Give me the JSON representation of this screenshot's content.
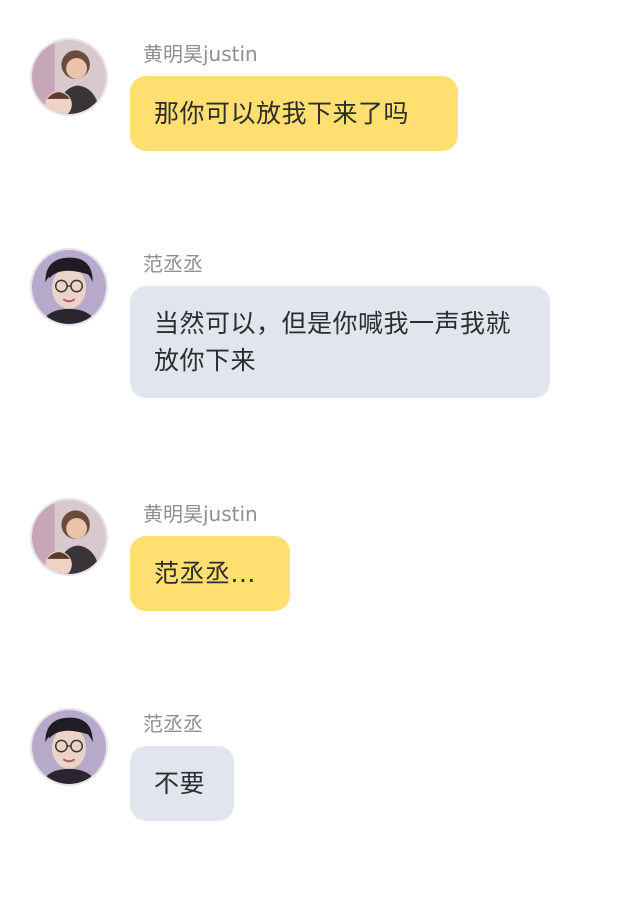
{
  "colors": {
    "bubble_justin": "#ffdf6f",
    "bubble_fan": "#e1e6ee",
    "name_text": "#8f8f8f",
    "message_text": "#2d2d2d"
  },
  "messages": [
    {
      "sender": "黄明昊justin",
      "text": "那你可以放我下来了吗",
      "avatar_icon": "justin-avatar"
    },
    {
      "sender": "范丞丞",
      "text": "当然可以，但是你喊我一声我就放你下来",
      "avatar_icon": "fan-avatar"
    },
    {
      "sender": "黄明昊justin",
      "text": "范丞丞...",
      "avatar_icon": "justin-avatar"
    },
    {
      "sender": "范丞丞",
      "text": "不要",
      "avatar_icon": "fan-avatar"
    }
  ]
}
